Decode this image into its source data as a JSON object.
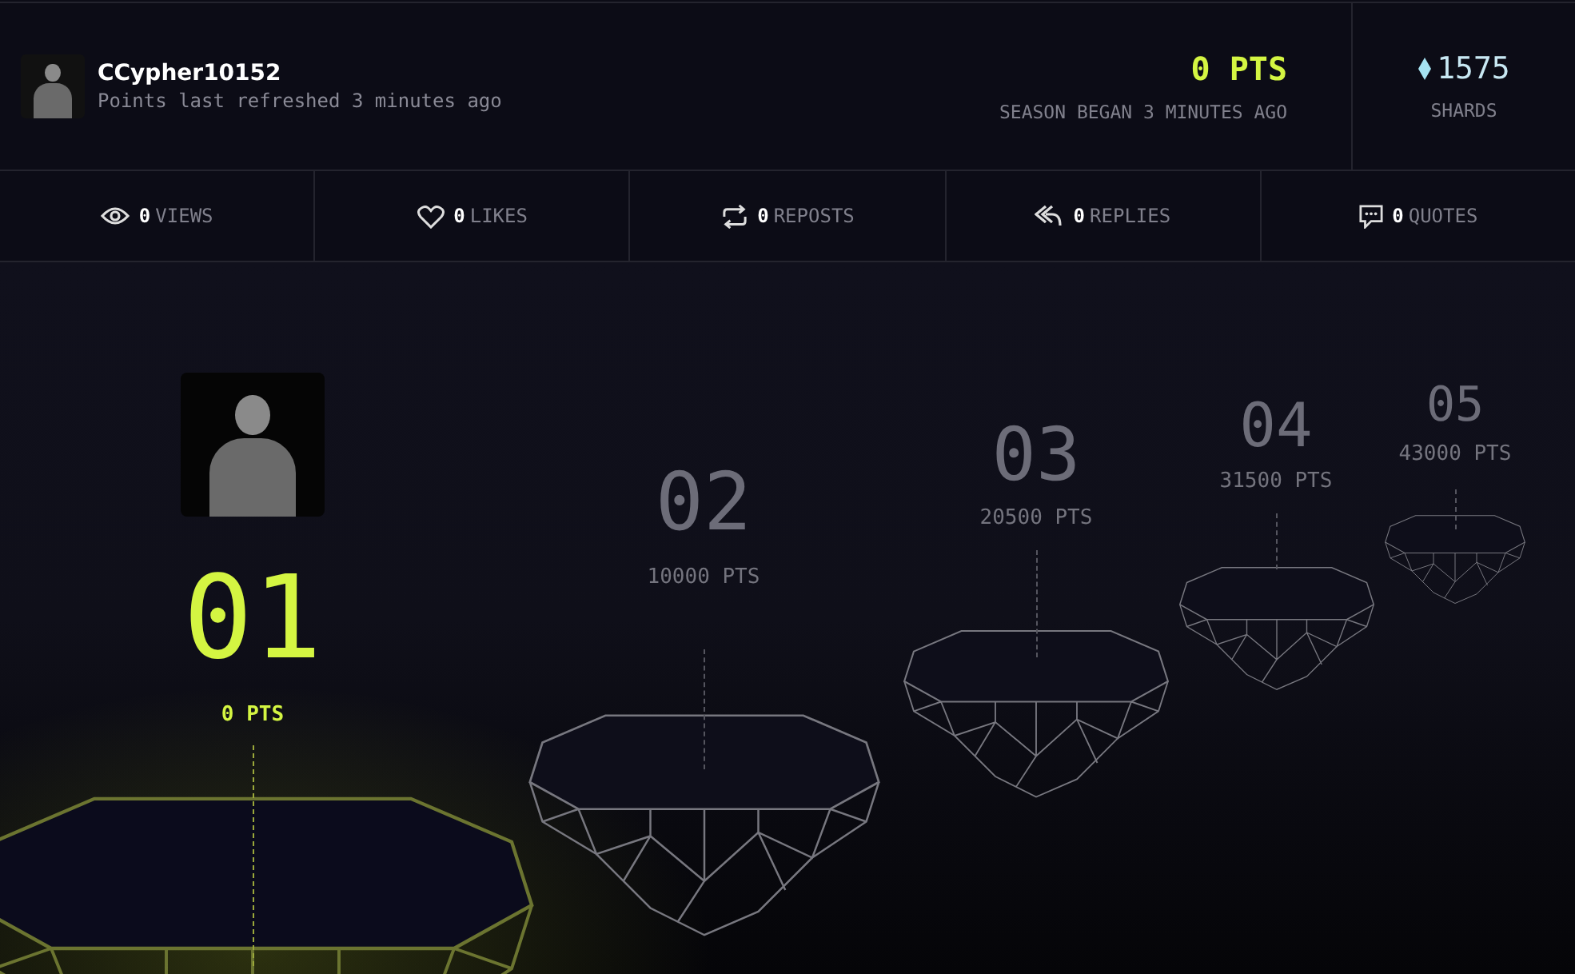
{
  "user": {
    "name": "CCypher10152",
    "refreshed": "Points last refreshed 3 minutes ago"
  },
  "season": {
    "points": "0 PTS",
    "began": "SEASON BEGAN 3 MINUTES AGO"
  },
  "shards": {
    "value": "1575",
    "label": "SHARDS"
  },
  "stats": [
    {
      "kind": "views",
      "count": "0",
      "label": "VIEWS"
    },
    {
      "kind": "likes",
      "count": "0",
      "label": "LIKES"
    },
    {
      "kind": "reposts",
      "count": "0",
      "label": "REPOSTS"
    },
    {
      "kind": "replies",
      "count": "0",
      "label": "REPLIES"
    },
    {
      "kind": "quotes",
      "count": "0",
      "label": "QUOTES"
    }
  ],
  "levels": [
    {
      "number": "01",
      "points": "0 PTS",
      "current": true
    },
    {
      "number": "02",
      "points": "10000 PTS",
      "current": false
    },
    {
      "number": "03",
      "points": "20500 PTS",
      "current": false
    },
    {
      "number": "04",
      "points": "31500 PTS",
      "current": false
    },
    {
      "number": "05",
      "points": "43000 PTS",
      "current": false
    }
  ]
}
